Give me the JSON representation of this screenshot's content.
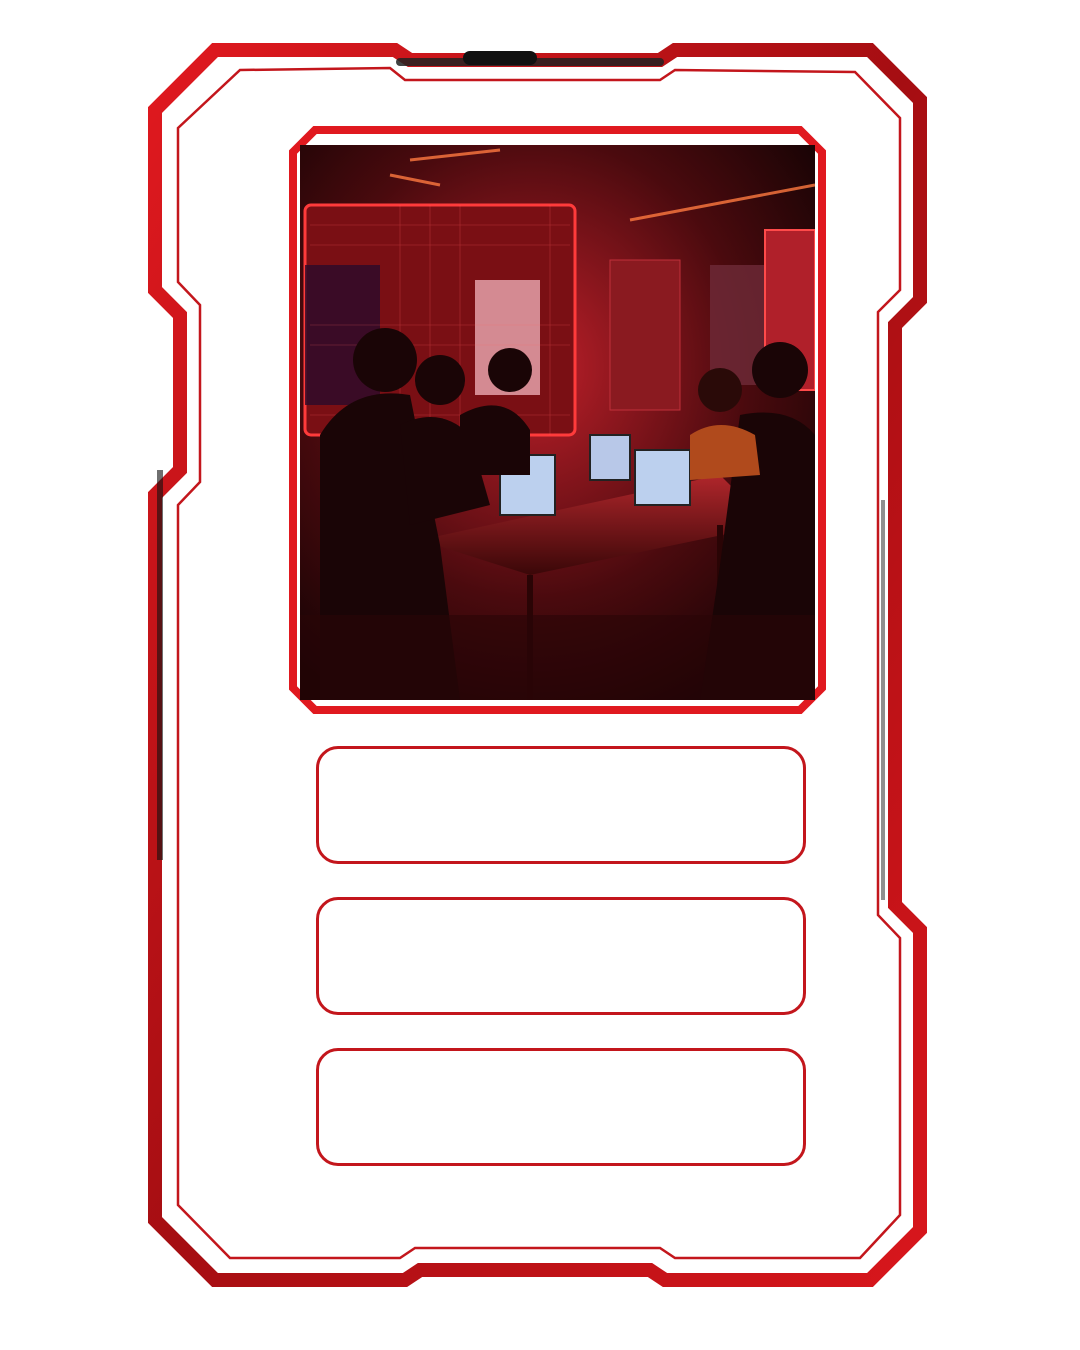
{
  "card": {
    "accent_color": "#c3161c",
    "dark_accent_color": "#7a0a0d",
    "background_color": "#ffffff",
    "image_description_icon": "photo-team-hackathon-red-room",
    "slots": [
      {
        "label": ""
      },
      {
        "label": ""
      },
      {
        "label": ""
      }
    ]
  }
}
